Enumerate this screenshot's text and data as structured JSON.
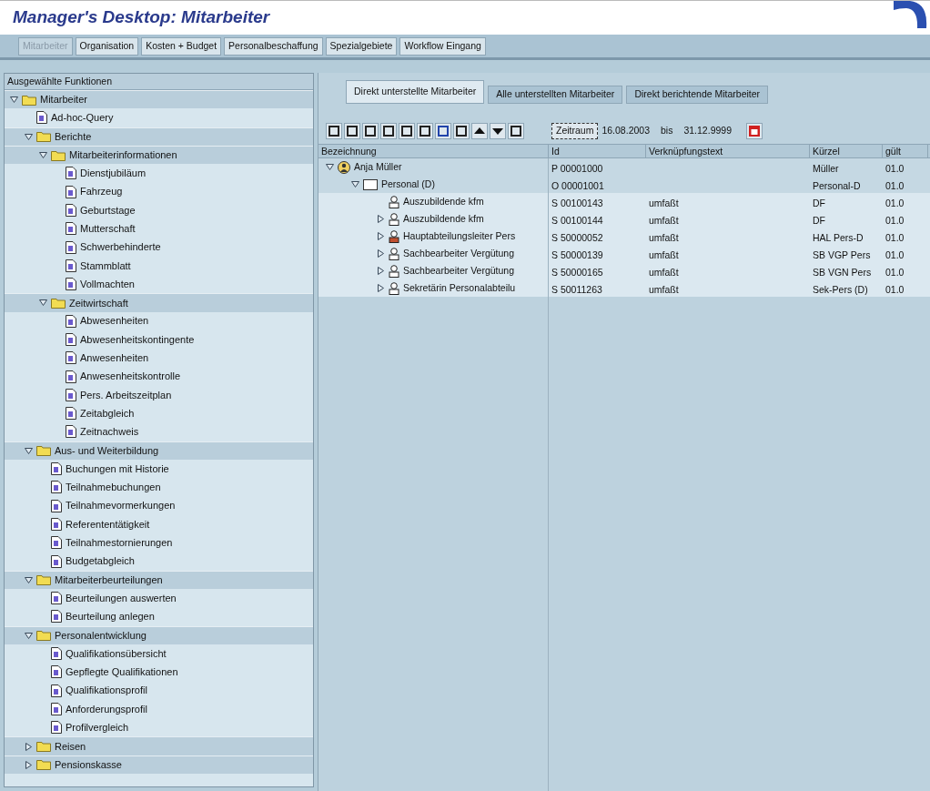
{
  "window": {
    "title": "Manager's Desktop: Mitarbeiter"
  },
  "tabs": [
    {
      "label": "Mitarbeiter",
      "selected": true
    },
    {
      "label": "Organisation",
      "selected": false
    },
    {
      "label": "Kosten + Budget",
      "selected": false
    },
    {
      "label": "Personalbeschaffung",
      "selected": false
    },
    {
      "label": "Spezialgebiete",
      "selected": false
    },
    {
      "label": "Workflow Eingang",
      "selected": false
    }
  ],
  "sidebar": {
    "title": "Ausgewählte Funktionen",
    "items": [
      {
        "kind": "folder",
        "label": "Mitarbeiter",
        "expanded": true,
        "children": [
          {
            "kind": "report",
            "label": "Ad-hoc-Query"
          },
          {
            "kind": "folder",
            "label": "Berichte",
            "expanded": true,
            "children": [
              {
                "kind": "folder",
                "label": "Mitarbeiterinformationen",
                "expanded": true,
                "children": [
                  {
                    "kind": "report",
                    "label": "Dienstjubiläum"
                  },
                  {
                    "kind": "report",
                    "label": "Fahrzeug"
                  },
                  {
                    "kind": "report",
                    "label": "Geburtstage"
                  },
                  {
                    "kind": "report",
                    "label": "Mutterschaft"
                  },
                  {
                    "kind": "report",
                    "label": "Schwerbehinderte"
                  },
                  {
                    "kind": "report",
                    "label": "Stammblatt"
                  },
                  {
                    "kind": "report",
                    "label": "Vollmachten"
                  }
                ]
              },
              {
                "kind": "folder",
                "label": "Zeitwirtschaft",
                "expanded": true,
                "children": [
                  {
                    "kind": "report",
                    "label": "Abwesenheiten"
                  },
                  {
                    "kind": "report",
                    "label": "Abwesenheitskontingente"
                  },
                  {
                    "kind": "report",
                    "label": "Anwesenheiten"
                  },
                  {
                    "kind": "report",
                    "label": "Anwesenheitskontrolle"
                  },
                  {
                    "kind": "report",
                    "label": "Pers. Arbeitszeitplan"
                  },
                  {
                    "kind": "report",
                    "label": "Zeitabgleich"
                  },
                  {
                    "kind": "report",
                    "label": "Zeitnachweis"
                  }
                ]
              }
            ]
          },
          {
            "kind": "folder",
            "label": "Aus- und Weiterbildung",
            "expanded": true,
            "children": [
              {
                "kind": "report",
                "label": "Buchungen mit Historie"
              },
              {
                "kind": "report",
                "label": "Teilnahmebuchungen"
              },
              {
                "kind": "report",
                "label": "Teilnahmevormerkungen"
              },
              {
                "kind": "report",
                "label": "Referententätigkeit"
              },
              {
                "kind": "report",
                "label": "Teilnahmestornierungen"
              },
              {
                "kind": "report",
                "label": "Budgetabgleich"
              }
            ]
          },
          {
            "kind": "folder",
            "label": "Mitarbeiterbeurteilungen",
            "expanded": true,
            "children": [
              {
                "kind": "report",
                "label": "Beurteilungen auswerten"
              },
              {
                "kind": "report",
                "label": "Beurteilung anlegen"
              }
            ]
          },
          {
            "kind": "folder",
            "label": "Personalentwicklung",
            "expanded": true,
            "children": [
              {
                "kind": "report",
                "label": "Qualifikationsübersicht"
              },
              {
                "kind": "report",
                "label": "Gepflegte Qualifikationen"
              },
              {
                "kind": "report",
                "label": "Qualifikationsprofil"
              },
              {
                "kind": "report",
                "label": "Anforderungsprofil"
              },
              {
                "kind": "report",
                "label": "Profilvergleich"
              }
            ]
          },
          {
            "kind": "folder",
            "label": "Reisen",
            "expanded": false
          },
          {
            "kind": "folder",
            "label": "Pensionskasse",
            "expanded": false
          }
        ]
      }
    ]
  },
  "view_tabs": [
    {
      "label": "Direkt unterstellte Mitarbeiter",
      "selected": true
    },
    {
      "label": "Alle unterstellten Mitarbeiter",
      "selected": false
    },
    {
      "label": "Direkt berichtende Mitarbeiter",
      "selected": false
    }
  ],
  "period": {
    "button": "Zeitraum",
    "from": "16.08.2003",
    "separator": "bis",
    "to": "31.12.9999"
  },
  "table": {
    "columns": [
      "Bezeichnung",
      "Id",
      "Verknüpfungstext",
      "Kürzel",
      "gült"
    ],
    "rows": [
      {
        "kind": "person",
        "expanded": true,
        "name": "Anja Müller",
        "id": "P 00001000",
        "short": "Müller",
        "valid": "01.0",
        "children": [
          {
            "kind": "org",
            "expanded": true,
            "name": "Personal (D)",
            "id": "O 00001001",
            "short": "Personal-D",
            "valid": "01.0",
            "children": [
              {
                "kind": "position",
                "name": "Auszubildende kfm",
                "id": "S 00100143",
                "link": "umfaßt",
                "short": "DF",
                "valid": "01.0"
              },
              {
                "kind": "position",
                "expanded": false,
                "name": "Auszubildende kfm",
                "id": "S 00100144",
                "link": "umfaßt",
                "short": "DF",
                "valid": "01.0"
              },
              {
                "kind": "head",
                "expanded": false,
                "name": "Hauptabteilungsleiter Pers",
                "id": "S 50000052",
                "link": "umfaßt",
                "short": "HAL Pers-D",
                "valid": "01.0"
              },
              {
                "kind": "position",
                "expanded": false,
                "name": "Sachbearbeiter Vergütung",
                "id": "S 50000139",
                "link": "umfaßt",
                "short": "SB VGP Pers",
                "valid": "01.0"
              },
              {
                "kind": "position",
                "expanded": false,
                "name": "Sachbearbeiter Vergütung",
                "id": "S 50000165",
                "link": "umfaßt",
                "short": "SB VGN Pers",
                "valid": "01.0"
              },
              {
                "kind": "position",
                "expanded": false,
                "name": "Sekretärin Personalabteilu",
                "id": "S 50011263",
                "link": "umfaßt",
                "short": "Sek-Pers (D)",
                "valid": "01.0"
              }
            ]
          }
        ]
      }
    ]
  }
}
